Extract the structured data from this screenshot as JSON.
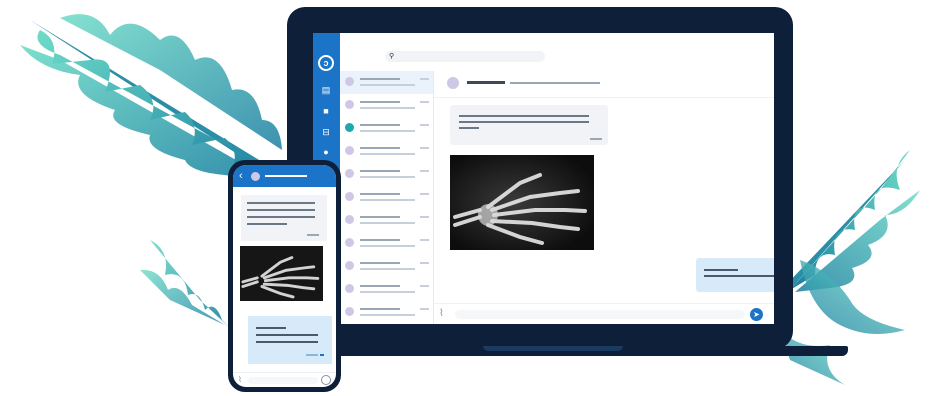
{
  "colors": {
    "frame": "#0e1f3a",
    "accent": "#1b74c8",
    "incoming_bubble": "#f1f3f6",
    "outgoing_bubble": "#d7eafa",
    "leaf_light": "#63d6c6",
    "leaf_dark": "#1a7fa0"
  },
  "laptop": {
    "rail_icons": [
      "logo-icon",
      "document-icon",
      "video-icon",
      "inbox-icon",
      "bell-icon"
    ],
    "search": {
      "icon": "search-icon"
    },
    "conversations": [
      {
        "active": true
      },
      {
        "active": false
      },
      {
        "active": false
      },
      {
        "active": false
      },
      {
        "active": false
      },
      {
        "active": false
      },
      {
        "active": false
      },
      {
        "active": false
      },
      {
        "active": false
      },
      {
        "active": false
      },
      {
        "active": false
      }
    ],
    "chat": {
      "messages": [
        "incoming-text",
        "incoming-image-xray",
        "outgoing-text"
      ],
      "composer": {
        "attach_icon": "paperclip-icon",
        "send_icon": "send-icon"
      }
    }
  },
  "phone": {
    "back_icon": "back-chevron-icon",
    "messages": [
      "incoming-text",
      "incoming-image-xray",
      "outgoing-text"
    ],
    "composer": {
      "attach_icon": "paperclip-icon",
      "emoji_icon": "emoji-icon"
    }
  }
}
